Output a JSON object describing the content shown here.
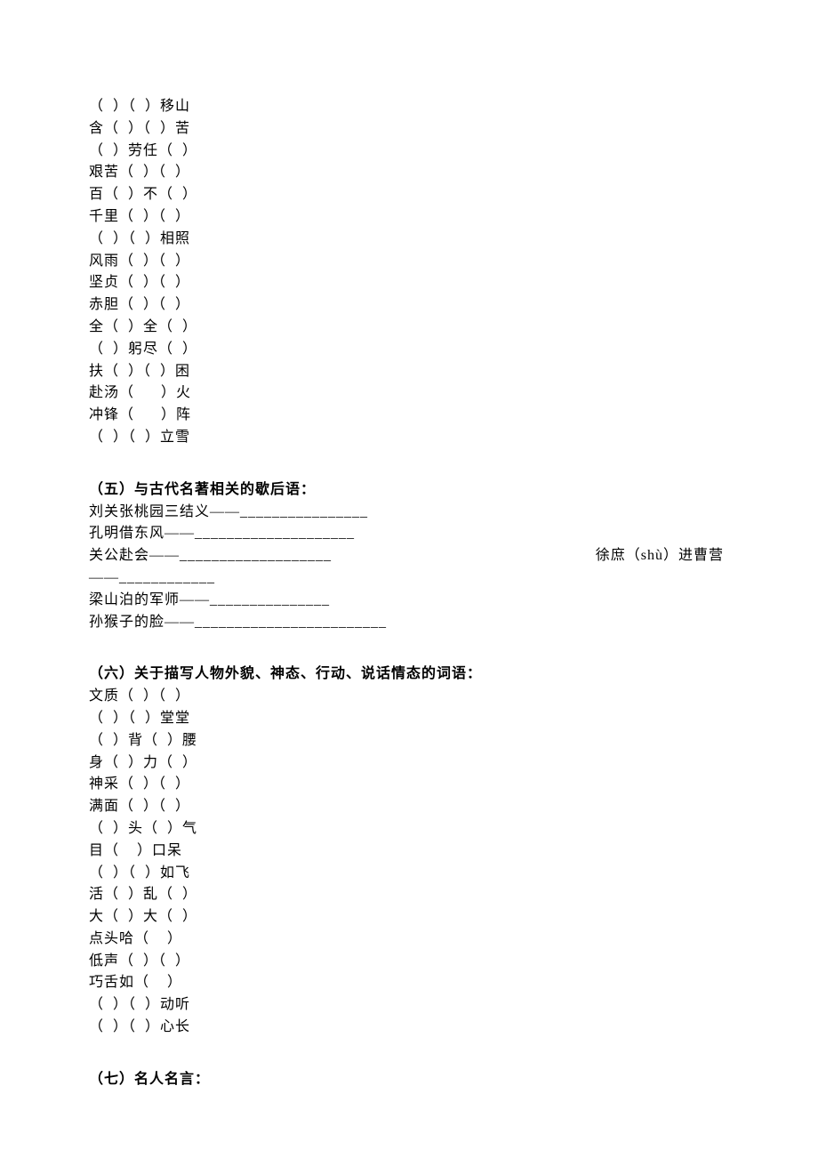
{
  "idioms_block1": [
    "（  ）（  ）移山",
    "含（  ）（  ）苦",
    "（  ）劳任（  ）",
    "艰苦（  ）（  ）",
    "百（  ）不（  ）",
    "千里（  ）（  ）",
    "（  ）（  ）相照",
    "风雨（  ）（  ）",
    "坚贞（  ）（  ）",
    "赤胆（  ）（  ）",
    "全（  ）全（  ）",
    "（  ）躬尽（  ）",
    "扶（  ）（  ）困",
    "赴汤（      ）火",
    "冲锋（      ）阵",
    "（  ）（  ）立雪"
  ],
  "section5": {
    "heading": "（五）与古代名著相关的歇后语：",
    "lines": [
      "刘关张桃园三结义——________________",
      "孔明借东风——____________________",
      "关公赴会——___________________",
      "——____________",
      "梁山泊的军师——_______________",
      "孙猴子的脸——________________________"
    ],
    "right_note": "徐庶（shù）进曹营"
  },
  "section6": {
    "heading": "（六）关于描写人物外貌、神态、行动、说话情态的词语：",
    "lines": [
      "文质（  ）（  ）",
      "（  ）（  ）堂堂",
      "（  ）背（  ）腰",
      "身（  ）力（  ）",
      "神采（  ）（  ）",
      "满面（  ）（  ）",
      "（  ）头（  ）气",
      "目（    ）口呆",
      "（  ）（  ）如飞",
      "活（  ）乱（  ）",
      "大（  ）大（  ）",
      "点头哈（    ）",
      "低声（  ）（  ）",
      "巧舌如（    ）",
      "（  ）（  ）动听",
      "（  ）（  ）心长"
    ]
  },
  "section7": {
    "heading": "（七）名人名言："
  }
}
